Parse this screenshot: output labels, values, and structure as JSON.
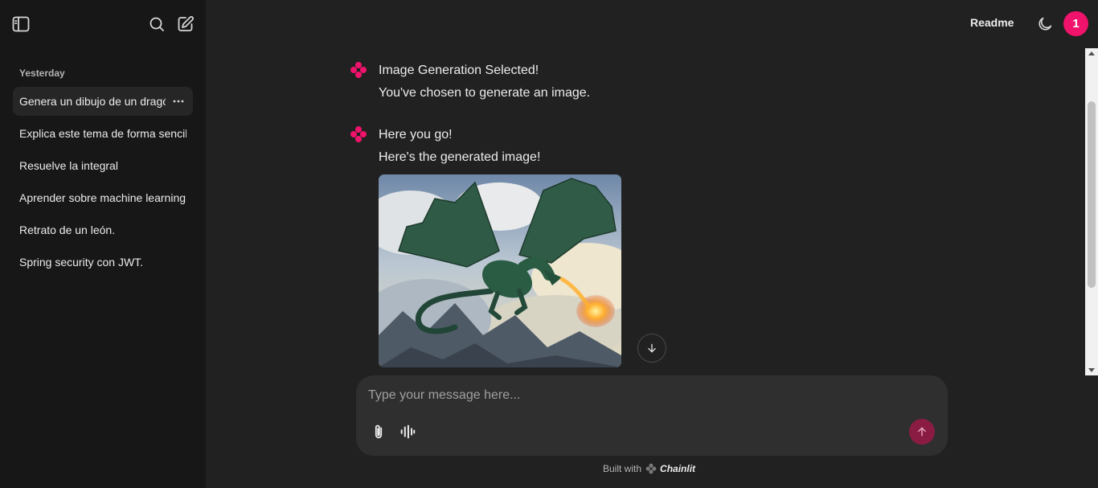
{
  "sidebar": {
    "section_label": "Yesterday",
    "threads": [
      {
        "label": "Genera un dibujo de un dragón"
      },
      {
        "label": "Explica este tema de forma sencilla"
      },
      {
        "label": "Resuelve la integral"
      },
      {
        "label": "Aprender sobre machine learning"
      },
      {
        "label": "Retrato de un león."
      },
      {
        "label": "Spring security con JWT."
      }
    ],
    "icons": {
      "toggle": "sidebar-toggle-icon",
      "search": "search-icon",
      "new_chat": "new-chat-icon",
      "thread_menu": "more-horizontal-icon"
    }
  },
  "header": {
    "readme_label": "Readme",
    "theme_icon": "moon-icon",
    "avatar_initial": "1"
  },
  "messages": [
    {
      "lines": [
        "Image Generation Selected!",
        "You've chosen to generate an image."
      ]
    },
    {
      "lines": [
        "Here you go!",
        "Here's the generated image!"
      ],
      "image": "green dragon breathing fire among clouds"
    }
  ],
  "composer": {
    "placeholder": "Type your message here...",
    "attach_icon": "paperclip-icon",
    "voice_icon": "audio-wave-icon",
    "send_icon": "arrow-up-icon"
  },
  "footer": {
    "built_with": "Built with",
    "brand": "Chainlit"
  },
  "colors": {
    "accent": "#f0136b",
    "send_button": "#8a1c44",
    "sidebar_bg": "#171717",
    "main_bg": "#212121",
    "composer_bg": "#2f2f2f"
  }
}
